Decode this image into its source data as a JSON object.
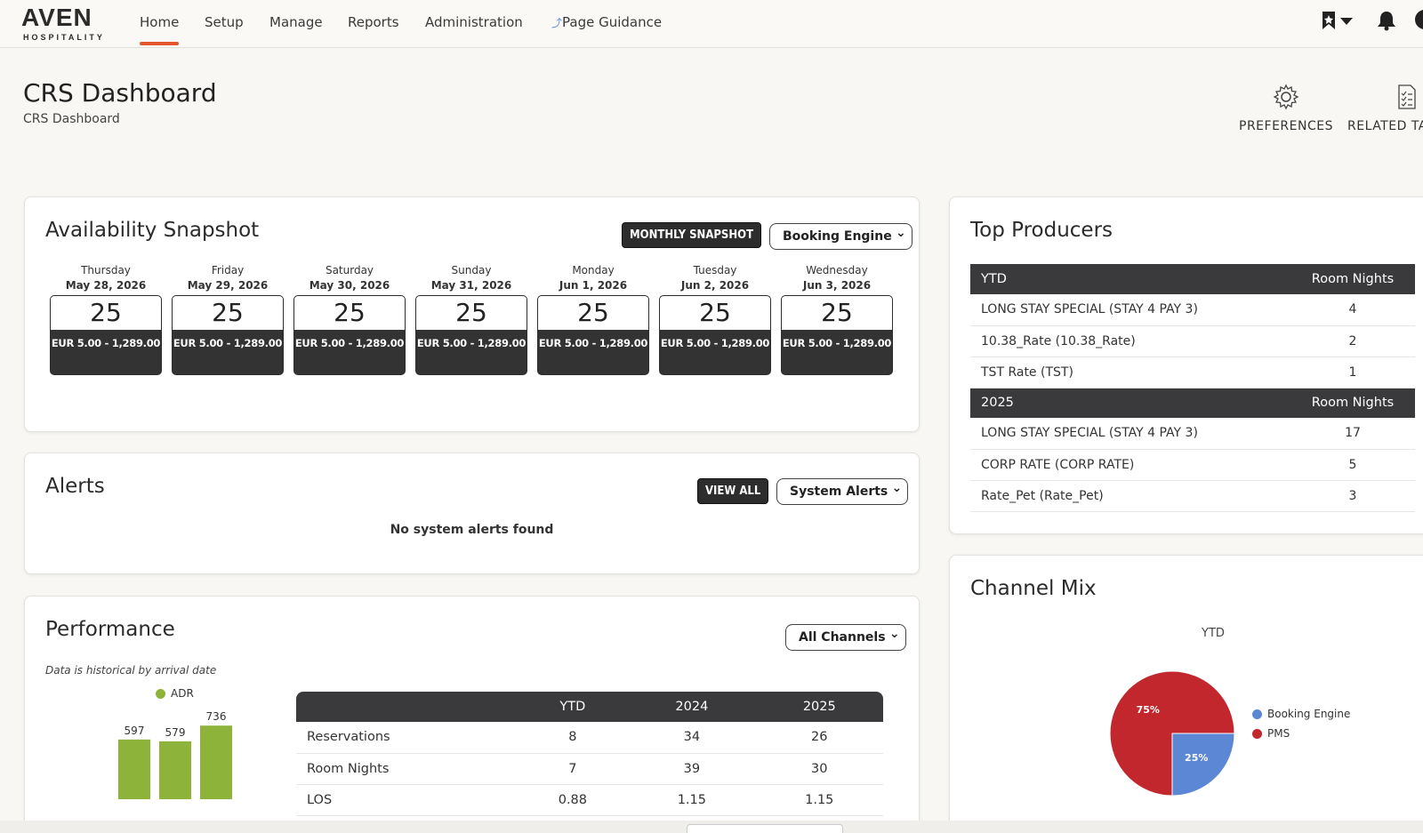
{
  "nav": {
    "logo_main": "AVEN",
    "logo_sub": "HOSPITALITY",
    "items": [
      "Home",
      "Setup",
      "Manage",
      "Reports",
      "Administration",
      "Page Guidance"
    ],
    "active": "Home"
  },
  "page": {
    "title": "CRS Dashboard",
    "breadcrumb": "CRS Dashboard",
    "actions": [
      "PREFERENCES",
      "RELATED TA"
    ]
  },
  "availability": {
    "title": "Availability Snapshot",
    "snapshot_button": "MONTHLY SNAPSHOT",
    "channel_select": "Booking Engine",
    "days": [
      {
        "weekday": "Thursday",
        "date": "May 28, 2026",
        "count": "25",
        "rate": "EUR 5.00 - 1,289.00"
      },
      {
        "weekday": "Friday",
        "date": "May 29, 2026",
        "count": "25",
        "rate": "EUR 5.00 - 1,289.00"
      },
      {
        "weekday": "Saturday",
        "date": "May 30, 2026",
        "count": "25",
        "rate": "EUR 5.00 - 1,289.00"
      },
      {
        "weekday": "Sunday",
        "date": "May 31, 2026",
        "count": "25",
        "rate": "EUR 5.00 - 1,289.00"
      },
      {
        "weekday": "Monday",
        "date": "Jun 1, 2026",
        "count": "25",
        "rate": "EUR 5.00 - 1,289.00"
      },
      {
        "weekday": "Tuesday",
        "date": "Jun 2, 2026",
        "count": "25",
        "rate": "EUR 5.00 - 1,289.00"
      },
      {
        "weekday": "Wednesday",
        "date": "Jun 3, 2026",
        "count": "25",
        "rate": "EUR 5.00 - 1,289.00"
      }
    ]
  },
  "alerts": {
    "title": "Alerts",
    "view_all": "VIEW ALL",
    "filter_select": "System Alerts",
    "empty_message": "No system alerts found"
  },
  "performance": {
    "title": "Performance",
    "channel_select": "All Channels",
    "note": "Data is historical by arrival date",
    "legend": "ADR",
    "bars": [
      597,
      579,
      736
    ],
    "bar_color": "#8db33a",
    "table": {
      "headers": [
        "",
        "YTD",
        "2024",
        "2025"
      ],
      "rows": [
        [
          "Reservations",
          "8",
          "34",
          "26"
        ],
        [
          "Room Nights",
          "7",
          "39",
          "30"
        ],
        [
          "LOS",
          "0.88",
          "1.15",
          "1.15"
        ]
      ]
    }
  },
  "top_producers": {
    "title": "Top Producers",
    "sections": [
      {
        "header": "YTD",
        "col": "Room Nights",
        "rows": [
          [
            "LONG STAY SPECIAL (STAY 4 PAY 3)",
            "4"
          ],
          [
            "10.38_Rate (10.38_Rate)",
            "2"
          ],
          [
            "TST Rate (TST)",
            "1"
          ]
        ]
      },
      {
        "header": "2025",
        "col": "Room Nights",
        "rows": [
          [
            "LONG STAY SPECIAL (STAY 4 PAY 3)",
            "17"
          ],
          [
            "CORP RATE (CORP RATE)",
            "5"
          ],
          [
            "Rate_Pet (Rate_Pet)",
            "3"
          ]
        ]
      }
    ]
  },
  "channel_mix": {
    "title": "Channel Mix",
    "subtitle": "YTD",
    "slices": [
      {
        "name": "Booking Engine",
        "value": 25,
        "label": "25%",
        "color": "#5b87d4"
      },
      {
        "name": "PMS",
        "value": 75,
        "label": "75%",
        "color": "#c1272d"
      }
    ]
  }
}
